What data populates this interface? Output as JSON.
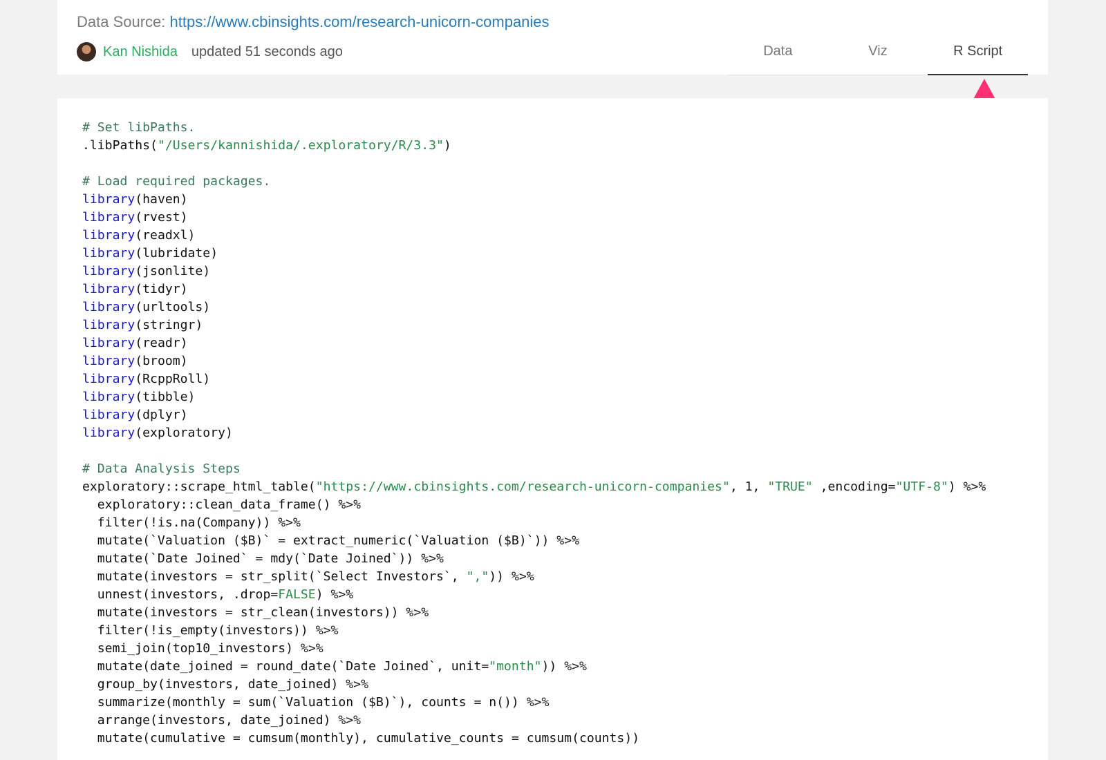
{
  "header": {
    "source_label": "Data Source:",
    "source_url": "https://www.cbinsights.com/research-unicorn-companies",
    "author": "Kan Nishida",
    "updated": "updated 51 seconds ago"
  },
  "tabs": [
    {
      "label": "Data",
      "active": false
    },
    {
      "label": "Viz",
      "active": false
    },
    {
      "label": "R Script",
      "active": true
    }
  ],
  "colors": {
    "arrow": "#ff2f72",
    "link": "#2a7bb8",
    "author": "#2daa5f",
    "keyword": "#1a1acf",
    "string": "#2a8a4a",
    "comment": "#3a7a5a"
  },
  "code_lines": [
    [
      {
        "t": "com",
        "v": "# Set libPaths."
      }
    ],
    [
      {
        "t": "txt",
        "v": ".libPaths("
      },
      {
        "t": "str",
        "v": "\"/Users/kannishida/.exploratory/R/3.3\""
      },
      {
        "t": "txt",
        "v": ")"
      }
    ],
    [],
    [
      {
        "t": "com",
        "v": "# Load required packages."
      }
    ],
    [
      {
        "t": "kw",
        "v": "library"
      },
      {
        "t": "txt",
        "v": "(haven)"
      }
    ],
    [
      {
        "t": "kw",
        "v": "library"
      },
      {
        "t": "txt",
        "v": "(rvest)"
      }
    ],
    [
      {
        "t": "kw",
        "v": "library"
      },
      {
        "t": "txt",
        "v": "(readxl)"
      }
    ],
    [
      {
        "t": "kw",
        "v": "library"
      },
      {
        "t": "txt",
        "v": "(lubridate)"
      }
    ],
    [
      {
        "t": "kw",
        "v": "library"
      },
      {
        "t": "txt",
        "v": "(jsonlite)"
      }
    ],
    [
      {
        "t": "kw",
        "v": "library"
      },
      {
        "t": "txt",
        "v": "(tidyr)"
      }
    ],
    [
      {
        "t": "kw",
        "v": "library"
      },
      {
        "t": "txt",
        "v": "(urltools)"
      }
    ],
    [
      {
        "t": "kw",
        "v": "library"
      },
      {
        "t": "txt",
        "v": "(stringr)"
      }
    ],
    [
      {
        "t": "kw",
        "v": "library"
      },
      {
        "t": "txt",
        "v": "(readr)"
      }
    ],
    [
      {
        "t": "kw",
        "v": "library"
      },
      {
        "t": "txt",
        "v": "(broom)"
      }
    ],
    [
      {
        "t": "kw",
        "v": "library"
      },
      {
        "t": "txt",
        "v": "(RcppRoll)"
      }
    ],
    [
      {
        "t": "kw",
        "v": "library"
      },
      {
        "t": "txt",
        "v": "(tibble)"
      }
    ],
    [
      {
        "t": "kw",
        "v": "library"
      },
      {
        "t": "txt",
        "v": "(dplyr)"
      }
    ],
    [
      {
        "t": "kw",
        "v": "library"
      },
      {
        "t": "txt",
        "v": "(exploratory)"
      }
    ],
    [],
    [
      {
        "t": "com",
        "v": "# Data Analysis Steps"
      }
    ],
    [
      {
        "t": "txt",
        "v": "exploratory::scrape_html_table("
      },
      {
        "t": "str",
        "v": "\"https://www.cbinsights.com/research-unicorn-companies\""
      },
      {
        "t": "txt",
        "v": ", 1, "
      },
      {
        "t": "str",
        "v": "\"TRUE\""
      },
      {
        "t": "txt",
        "v": " ,encoding="
      },
      {
        "t": "str",
        "v": "\"UTF-8\""
      },
      {
        "t": "txt",
        "v": ") "
      },
      {
        "t": "op",
        "v": "%>%"
      }
    ],
    [
      {
        "t": "txt",
        "v": "  exploratory::clean_data_frame() "
      },
      {
        "t": "op",
        "v": "%>%"
      }
    ],
    [
      {
        "t": "txt",
        "v": "  filter(!is.na(Company)) "
      },
      {
        "t": "op",
        "v": "%>%"
      }
    ],
    [
      {
        "t": "txt",
        "v": "  mutate(`Valuation ($B)` = extract_numeric(`Valuation ($B)`)) "
      },
      {
        "t": "op",
        "v": "%>%"
      }
    ],
    [
      {
        "t": "txt",
        "v": "  mutate(`Date Joined` = mdy(`Date Joined`)) "
      },
      {
        "t": "op",
        "v": "%>%"
      }
    ],
    [
      {
        "t": "txt",
        "v": "  mutate(investors = str_split(`Select Investors`, "
      },
      {
        "t": "str",
        "v": "\",\""
      },
      {
        "t": "txt",
        "v": ")) "
      },
      {
        "t": "op",
        "v": "%>%"
      }
    ],
    [
      {
        "t": "txt",
        "v": "  unnest(investors, .drop="
      },
      {
        "t": "lit",
        "v": "FALSE"
      },
      {
        "t": "txt",
        "v": ") "
      },
      {
        "t": "op",
        "v": "%>%"
      }
    ],
    [
      {
        "t": "txt",
        "v": "  mutate(investors = str_clean(investors)) "
      },
      {
        "t": "op",
        "v": "%>%"
      }
    ],
    [
      {
        "t": "txt",
        "v": "  filter(!is_empty(investors)) "
      },
      {
        "t": "op",
        "v": "%>%"
      }
    ],
    [
      {
        "t": "txt",
        "v": "  semi_join(top10_investors) "
      },
      {
        "t": "op",
        "v": "%>%"
      }
    ],
    [
      {
        "t": "txt",
        "v": "  mutate(date_joined = round_date(`Date Joined`, unit="
      },
      {
        "t": "str",
        "v": "\"month\""
      },
      {
        "t": "txt",
        "v": ")) "
      },
      {
        "t": "op",
        "v": "%>%"
      }
    ],
    [
      {
        "t": "txt",
        "v": "  group_by(investors, date_joined) "
      },
      {
        "t": "op",
        "v": "%>%"
      }
    ],
    [
      {
        "t": "txt",
        "v": "  summarize(monthly = sum(`Valuation ($B)`), counts = n()) "
      },
      {
        "t": "op",
        "v": "%>%"
      }
    ],
    [
      {
        "t": "txt",
        "v": "  arrange(investors, date_joined) "
      },
      {
        "t": "op",
        "v": "%>%"
      }
    ],
    [
      {
        "t": "txt",
        "v": "  mutate(cumulative = cumsum(monthly), cumulative_counts = cumsum(counts))"
      }
    ]
  ]
}
